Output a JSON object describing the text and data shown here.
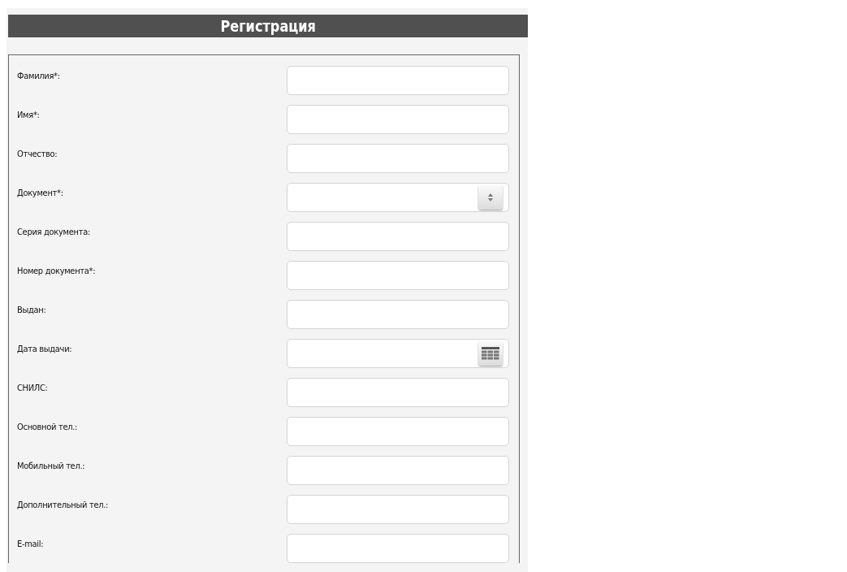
{
  "header": {
    "title": "Регистрация"
  },
  "fields": [
    {
      "label": "Фамилия*:",
      "kind": "text"
    },
    {
      "label": "Имя*:",
      "kind": "text"
    },
    {
      "label": "Отчество:",
      "kind": "text"
    },
    {
      "label": "Документ*:",
      "kind": "select"
    },
    {
      "label": "Серия документа:",
      "kind": "text"
    },
    {
      "label": "Номер документа*:",
      "kind": "text"
    },
    {
      "label": "Выдан:",
      "kind": "text"
    },
    {
      "label": "Дата выдачи:",
      "kind": "date"
    },
    {
      "label": "СНИЛС:",
      "kind": "text"
    },
    {
      "label": "Основной тел.:",
      "kind": "text"
    },
    {
      "label": "Мобильный тел.:",
      "kind": "text"
    },
    {
      "label": "Дополнительный тел.:",
      "kind": "text"
    },
    {
      "label": "E-mail:",
      "kind": "text"
    }
  ]
}
